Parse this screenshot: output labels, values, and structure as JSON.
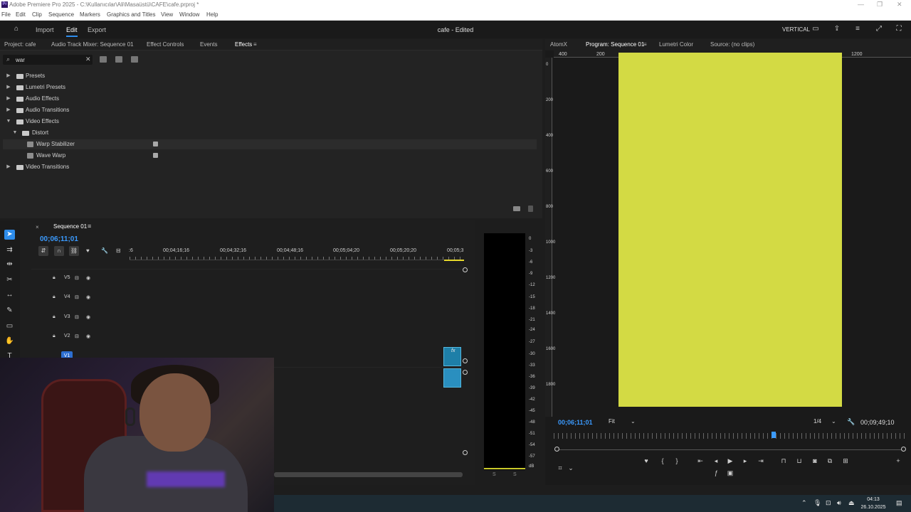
{
  "window": {
    "title": "Adobe Premiere Pro 2025 - C:\\Kullanıcılar\\Ali\\Masaüstü\\CAFE\\cafe.prproj *",
    "logo": "Pr",
    "controls": [
      "—",
      "❐",
      "✕"
    ]
  },
  "menu": [
    "File",
    "Edit",
    "Clip",
    "Sequence",
    "Markers",
    "Graphics and Titles",
    "View",
    "Window",
    "Help"
  ],
  "header": {
    "tabs": [
      "Import",
      "Edit",
      "Export"
    ],
    "active_tab": "Edit",
    "project_title": "cafe - Edited",
    "workspace": "VERTICAL"
  },
  "effects_panel": {
    "tabs": [
      "Project: cafe",
      "Audio Track Mixer: Sequence 01",
      "Effect Controls",
      "Events",
      "Effects"
    ],
    "active_tab": "Effects",
    "search_value": "war",
    "tree": [
      {
        "label": "Presets"
      },
      {
        "label": "Lumetri Presets"
      },
      {
        "label": "Audio Effects"
      },
      {
        "label": "Audio Transitions"
      },
      {
        "label": "Video Effects"
      },
      {
        "label": "Distort"
      },
      {
        "label": "Warp Stabilizer"
      },
      {
        "label": "Wave Warp"
      },
      {
        "label": "Video Transitions"
      }
    ]
  },
  "timeline": {
    "sequence_name": "Sequence 01",
    "timecode": "00;06;11;01",
    "ruler_labels": [
      ":6",
      "00;04;16;16",
      "00;04;32;16",
      "00;04;48;16",
      "00;05;04;20",
      "00;05;20;20",
      "00;05;3"
    ],
    "tracks": [
      "V5",
      "V4",
      "V3",
      "V2",
      "V1"
    ],
    "clip_label": "fx"
  },
  "audio_meter": {
    "db_labels": [
      "0",
      "-3",
      "-6",
      "-9",
      "-12",
      "-15",
      "-18",
      "-21",
      "-24",
      "-27",
      "-30",
      "-33",
      "-36",
      "-39",
      "-42",
      "-45",
      "-48",
      "-51",
      "-54",
      "-57",
      "dB"
    ],
    "solo": [
      "S",
      "S"
    ]
  },
  "program_monitor": {
    "tabs": [
      "AtomX",
      "Program: Sequence 01",
      "Lumetri Color",
      "Source: (no clips)"
    ],
    "active_tab": "Program: Sequence 01",
    "h_ruler": [
      "400",
      "200",
      "1200"
    ],
    "v_ruler": [
      "0",
      "200",
      "400",
      "600",
      "800",
      "1000",
      "1200",
      "1400",
      "1600",
      "1800"
    ],
    "frame_color": "#d3da44",
    "timecode": "00;06;11;01",
    "zoom": "Fit",
    "resolution": "1/4",
    "duration": "00;09;49;10"
  },
  "taskbar": {
    "time": "04:13",
    "date": "26.10.2025"
  },
  "colors": {
    "accent": "#2d8ceb",
    "timecode": "#3b9bff",
    "clip": "#1e7fa8"
  }
}
